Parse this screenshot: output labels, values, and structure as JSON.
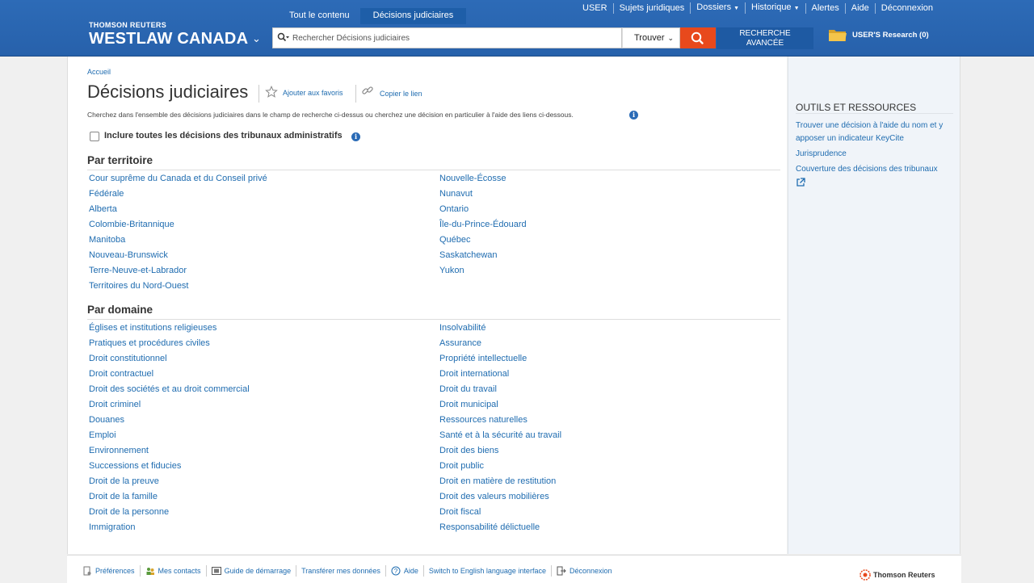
{
  "header": {
    "brand_small": "THOMSON REUTERS",
    "brand_big": "WESTLAW CANADA",
    "scope_tabs": [
      "Tout le contenu",
      "Décisions judiciaires"
    ],
    "nav": [
      "USER",
      "Sujets juridiques",
      "Dossiers",
      "Historique",
      "Alertes",
      "Aide",
      "Déconnexion"
    ],
    "search_placeholder": "Rechercher Décisions judiciaires",
    "find_label": "Trouver",
    "advanced_search": [
      "RECHERCHE",
      "AVANCÉE"
    ],
    "research_folder": "USER'S Research (0)"
  },
  "breadcrumb": "Accueil",
  "page_title": "Décisions judiciaires",
  "favorites_label": "Ajouter aux favoris",
  "copy_link_label": "Copier le lien",
  "intro": "Cherchez dans l'ensemble des décisions judiciaires dans le champ de recherche ci-dessus ou cherchez une décision en particulier à l'aide des liens ci-dessous.",
  "admin_checkbox_label": "Inclure toutes les décisions des tribunaux administratifs",
  "territory": {
    "title": "Par territoire",
    "left": [
      "Cour suprême du Canada et du Conseil privé",
      "Fédérale",
      "Alberta",
      "Colombie-Britannique",
      "Manitoba",
      "Nouveau-Brunswick",
      "Terre-Neuve-et-Labrador",
      "Territoires du Nord-Ouest"
    ],
    "right": [
      "Nouvelle-Écosse",
      "Nunavut",
      "Ontario",
      "Île-du-Prince-Édouard",
      "Québec",
      "Saskatchewan",
      "Yukon"
    ]
  },
  "domain": {
    "title": "Par domaine",
    "left": [
      "Églises et institutions religieuses",
      "Pratiques et procédures civiles",
      "Droit constitutionnel",
      "Droit contractuel",
      "Droit des sociétés et au droit commercial",
      "Droit criminel",
      "Douanes",
      "Emploi",
      "Environnement",
      "Successions et fiducies",
      "Droit de la preuve",
      "Droit de la famille",
      "Droit de la personne",
      "Immigration"
    ],
    "right": [
      "Insolvabilité",
      "Assurance",
      "Propriété intellectuelle",
      "Droit international",
      "Droit du travail",
      "Droit municipal",
      "Ressources naturelles",
      "Santé et à la sécurité au travail",
      "Droit des biens",
      "Droit public",
      "Droit en matière de restitution",
      "Droit des valeurs mobilières",
      "Droit fiscal",
      "Responsabilité délictuelle"
    ]
  },
  "tools": {
    "title": "OUTILS ET RESSOURCES",
    "links": [
      "Trouver une décision à l'aide du nom et y apposer un indicateur KeyCite",
      "Jurisprudence",
      "Couverture des décisions des tribunaux"
    ]
  },
  "footer": {
    "links": [
      "Préférences",
      "Mes contacts",
      "Guide de démarrage",
      "Transférer mes données",
      "Aide",
      "Switch to English language interface",
      "Déconnexion"
    ],
    "logo": "Thomson Reuters"
  },
  "colors": {
    "header": "#2761ab",
    "link": "#1f6cb0",
    "search_button": "#e8491c"
  }
}
